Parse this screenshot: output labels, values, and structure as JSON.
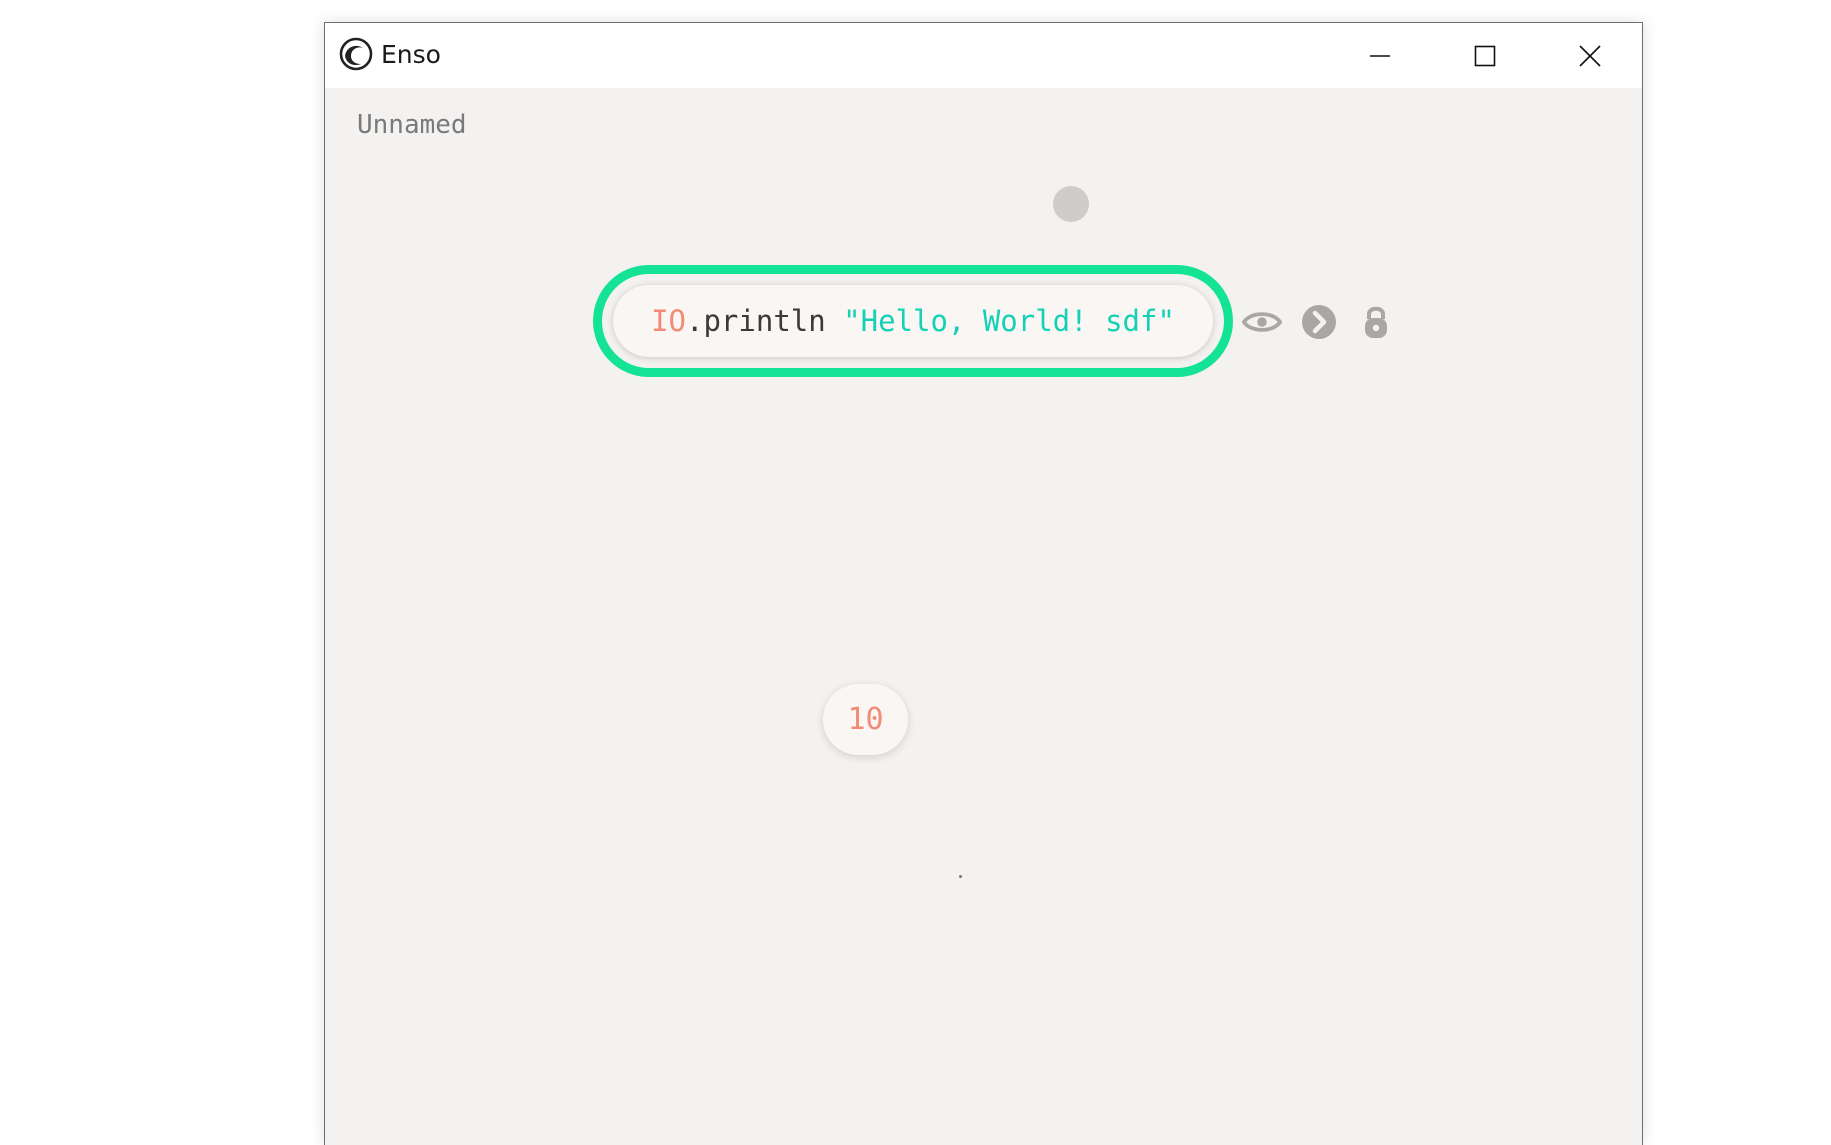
{
  "window": {
    "title": "Enso",
    "app_icon": "enso-logo-icon",
    "controls": {
      "minimize_icon": "minimize-icon",
      "maximize_icon": "maximize-icon",
      "close_icon": "close-icon"
    }
  },
  "project": {
    "name": "Unnamed"
  },
  "nodes": {
    "println_node": {
      "type_token": "IO",
      "method_token": ".println",
      "string_token": "\"Hello, World! sdf\"",
      "selected": true
    },
    "literal_node": {
      "value": "10"
    }
  },
  "node_actions": [
    "eye-icon",
    "chevron-right-icon",
    "lock-icon"
  ],
  "colors": {
    "selection": "#14e396",
    "type_token": "#f28a75",
    "string_token": "#14d1b6",
    "identifier": "#3a3a3a",
    "canvas": "#f4f2f0",
    "icon_gray": "#a9a7a5"
  }
}
